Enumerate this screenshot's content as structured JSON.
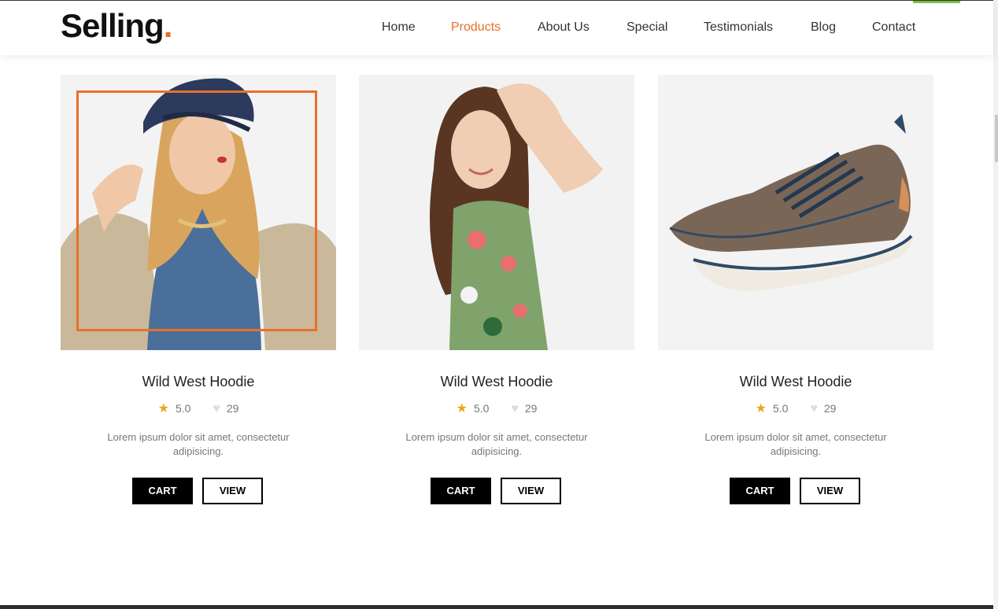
{
  "brand": {
    "name": "Selling",
    "dot": ".",
    "accent_color": "#e8702a"
  },
  "nav": {
    "items": [
      {
        "label": "Home",
        "active": false
      },
      {
        "label": "Products",
        "active": true
      },
      {
        "label": "About Us",
        "active": false
      },
      {
        "label": "Special",
        "active": false
      },
      {
        "label": "Testimonials",
        "active": false
      },
      {
        "label": "Blog",
        "active": false
      },
      {
        "label": "Contact",
        "active": false
      }
    ]
  },
  "products": [
    {
      "title": "Wild West Hoodie",
      "rating": "5.0",
      "likes": "29",
      "description": "Lorem ipsum dolor sit amet, consectetur adipisicing.",
      "cart_label": "CART",
      "view_label": "VIEW",
      "image": "woman-hat-denim-shirt"
    },
    {
      "title": "Wild West Hoodie",
      "rating": "5.0",
      "likes": "29",
      "description": "Lorem ipsum dolor sit amet, consectetur adipisicing.",
      "cart_label": "CART",
      "view_label": "VIEW",
      "image": "woman-floral-dress"
    },
    {
      "title": "Wild West Hoodie",
      "rating": "5.0",
      "likes": "29",
      "description": "Lorem ipsum dolor sit amet, consectetur adipisicing.",
      "cart_label": "CART",
      "view_label": "VIEW",
      "image": "brown-sneaker"
    }
  ],
  "icons": {
    "rating": "star-icon",
    "likes": "heart-icon"
  }
}
